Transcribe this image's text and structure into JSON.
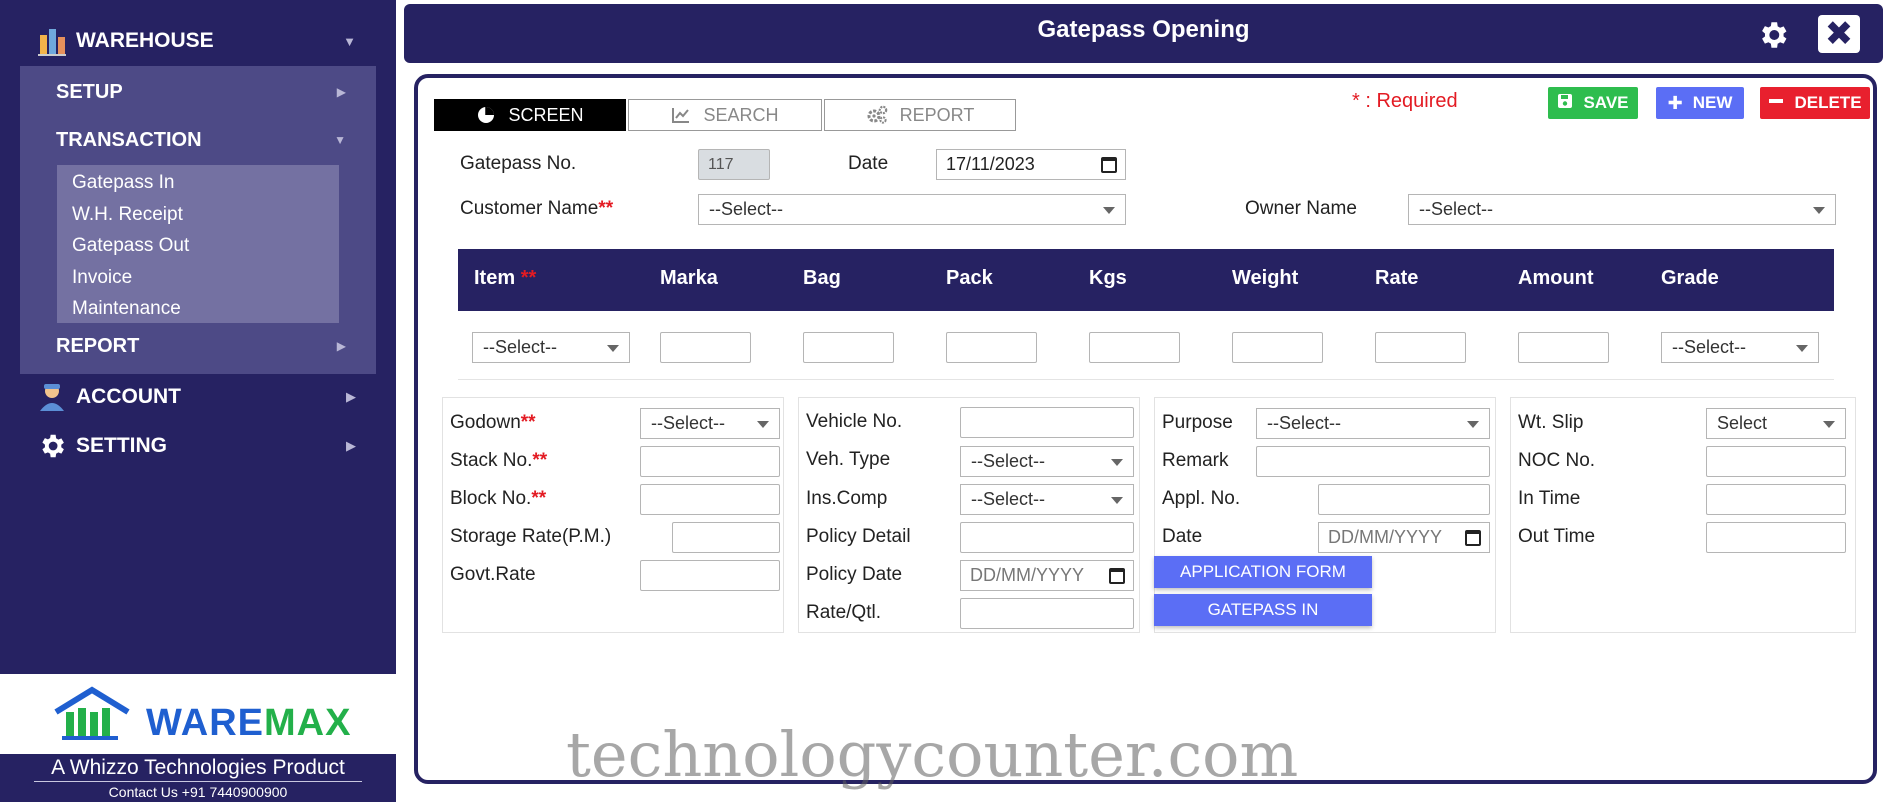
{
  "sidebar": {
    "warehouse_label": "WAREHOUSE",
    "setup_label": "SETUP",
    "transaction_label": "TRANSACTION",
    "transaction_items": [
      "Gatepass In",
      "W.H. Receipt",
      "Gatepass Out",
      "Invoice",
      "Maintenance"
    ],
    "report_label": "REPORT",
    "account_label": "ACCOUNT",
    "setting_label": "SETTING",
    "logo": {
      "part1": "WARE",
      "part2": "MAX"
    },
    "tagline": "A Whizzo Technologies Product",
    "contact": "Contact Us +91 7440900900"
  },
  "header": {
    "title": "Gatepass Opening"
  },
  "tabs": {
    "screen": "SCREEN",
    "search": "SEARCH",
    "report": "REPORT"
  },
  "required_note": "* : Required",
  "actions": {
    "save": "SAVE",
    "new": "NEW",
    "delete": "DELETE"
  },
  "form": {
    "gatepass_no_label": "Gatepass No.",
    "gatepass_no_value": "117",
    "date_label": "Date",
    "date_value": "17/11/2023",
    "customer_label": "Customer Name",
    "customer_value": "--Select--",
    "owner_label": "Owner Name",
    "owner_value": "--Select--"
  },
  "grid": {
    "columns": [
      "Item",
      "Marka",
      "Bag",
      "Pack",
      "Kgs",
      "Weight",
      "Rate",
      "Amount",
      "Grade"
    ],
    "item_select": "--Select--",
    "grade_select": "--Select--"
  },
  "godown_section": {
    "godown_label": "Godown",
    "godown_value": "--Select--",
    "stack_label": "Stack No.",
    "block_label": "Block No.",
    "storage_rate_label": "Storage Rate(P.M.)",
    "govt_rate_label": "Govt.Rate"
  },
  "vehicle_section": {
    "vehicle_no_label": "Vehicle No.",
    "veh_type_label": "Veh. Type",
    "veh_type_value": "--Select--",
    "ins_comp_label": "Ins.Comp",
    "ins_comp_value": "--Select--",
    "policy_detail_label": "Policy Detail",
    "policy_date_label": "Policy Date",
    "policy_date_placeholder": "DD/MM/YYYY",
    "rate_qtl_label": "Rate/Qtl."
  },
  "purpose_section": {
    "purpose_label": "Purpose",
    "purpose_value": "--Select--",
    "remark_label": "Remark",
    "appl_no_label": "Appl. No.",
    "date_label": "Date",
    "date_placeholder": "DD/MM/YYYY",
    "application_form_btn": "APPLICATION FORM",
    "gatepass_in_btn": "GATEPASS IN"
  },
  "slip_section": {
    "wt_slip_label": "Wt. Slip",
    "wt_slip_value": "Select",
    "noc_label": "NOC No.",
    "in_time_label": "In Time",
    "out_time_label": "Out Time"
  },
  "watermark": "technologycounter.com",
  "colors": {
    "navy": "#262262",
    "submenu": "#4d4a86",
    "submenu_list": "#7471a2",
    "save": "#2ebd4e",
    "new": "#5b6ef5",
    "delete": "#e8202e",
    "required": "#e31b23"
  }
}
